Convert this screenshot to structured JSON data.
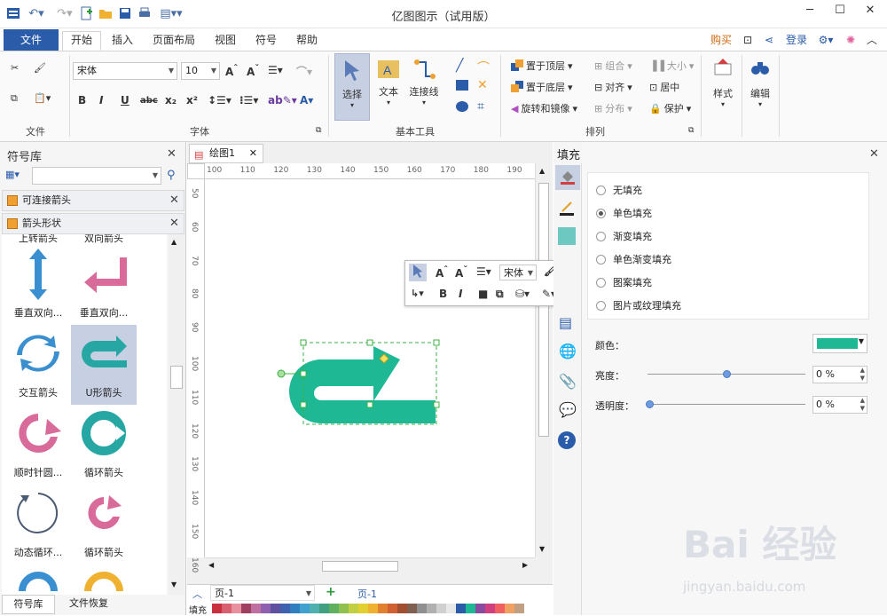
{
  "window": {
    "title": "亿图图示（试用版）"
  },
  "menu": {
    "file": "文件",
    "tabs": [
      "开始",
      "插入",
      "页面布局",
      "视图",
      "符号",
      "帮助"
    ],
    "buy": "购买",
    "login": "登录"
  },
  "ribbon": {
    "groups": {
      "file": "文件",
      "font": "字体",
      "basic_tools": "基本工具",
      "arrange": "排列"
    },
    "font_name": "宋体",
    "font_size": "10",
    "select": "选择",
    "text": "文本",
    "connector": "连接线",
    "bring_front": "置于顶层",
    "send_back": "置于底层",
    "rotate_mirror": "旋转和镜像",
    "group": "组合",
    "align": "对齐",
    "distribute": "分布",
    "size": "大小",
    "center": "居中",
    "protect": "保护",
    "style": "样式",
    "edit": "编辑"
  },
  "left_panel": {
    "title": "符号库",
    "libraries": [
      "可连接箭头",
      "箭头形状"
    ],
    "top_partial": [
      "上转箭头",
      "双向箭头"
    ],
    "shapes": [
      {
        "label": "垂直双向...",
        "color": "#3a8fd0"
      },
      {
        "label": "垂直双向...",
        "color": "#d96b9a"
      },
      {
        "label": "交互箭头",
        "color": "#3a8fd0"
      },
      {
        "label": "U形箭头",
        "color": "#27a7a3"
      },
      {
        "label": "顺时针圆...",
        "color": "#d96b9a"
      },
      {
        "label": "循环箭头",
        "color": "#27a7a3"
      },
      {
        "label": "动态循环...",
        "color": "#4a5a70"
      },
      {
        "label": "循环箭头",
        "color": "#d96b9a"
      }
    ],
    "bottom_tabs": [
      "符号库",
      "文件恢复"
    ]
  },
  "canvas": {
    "doc_tab": "绘图1",
    "ruler_h": [
      "100",
      "110",
      "120",
      "130",
      "140",
      "150",
      "160",
      "170",
      "180",
      "190"
    ],
    "ruler_v": [
      "50",
      "60",
      "70",
      "80",
      "90",
      "100",
      "110",
      "120",
      "130",
      "140",
      "150",
      "160"
    ],
    "page_select": "页-1",
    "page_tab": "页-1",
    "fill_label": "填充",
    "shape_color": "#1fb894"
  },
  "float_toolbar": {
    "font": "宋体"
  },
  "fill_panel": {
    "title": "填充",
    "options": [
      "无填充",
      "单色填充",
      "渐变填充",
      "单色渐变填充",
      "图案填充",
      "图片或纹理填充"
    ],
    "selected": 1,
    "color_label": "颜色：",
    "color_value": "#1fb894",
    "brightness_label": "亮度：",
    "brightness_value": "0 %",
    "brightness_level": 0.5,
    "transparency_label": "透明度：",
    "transparency_value": "0 %",
    "transparency_level": 0.0
  },
  "watermark": {
    "logo": "Bai 经验",
    "url": "jingyan.baidu.com"
  }
}
